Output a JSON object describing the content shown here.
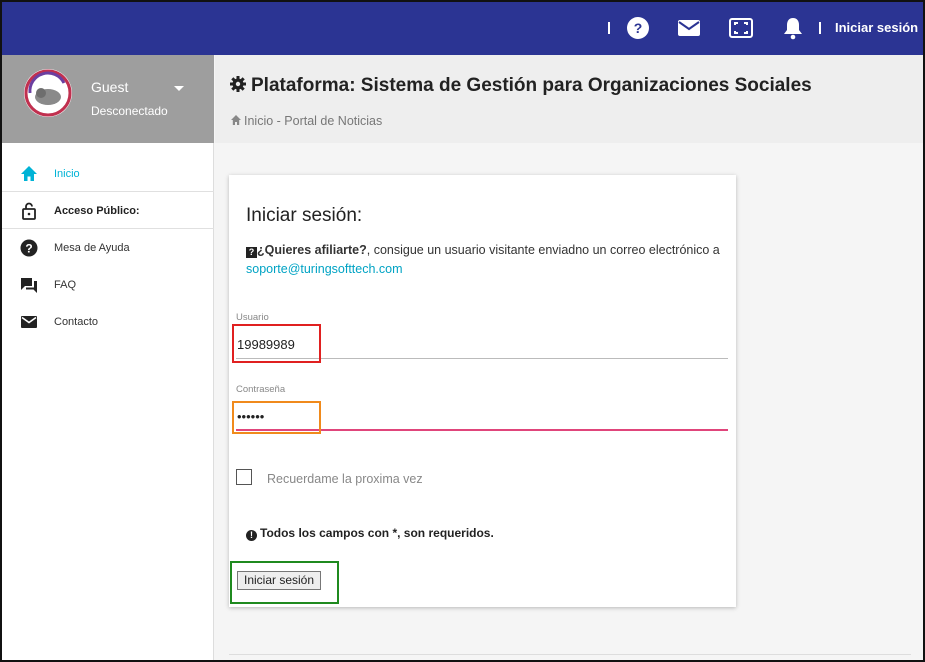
{
  "header": {
    "login_link": "Iniciar sesión",
    "icons": [
      "help-icon",
      "mail-icon",
      "fullscreen-icon",
      "bell-icon"
    ]
  },
  "user_panel": {
    "name": "Guest",
    "status": "Desconectado"
  },
  "sidebar": {
    "items": [
      {
        "label": "Inicio",
        "icon": "home-icon",
        "active": true
      },
      {
        "label": "Acceso Público:",
        "icon": "lock-open-icon",
        "section": true
      },
      {
        "label": "Mesa de Ayuda",
        "icon": "help-circle-icon"
      },
      {
        "label": "FAQ",
        "icon": "forum-icon"
      },
      {
        "label": "Contacto",
        "icon": "mail-icon"
      }
    ]
  },
  "page": {
    "title": "Plataforma: Sistema de Gestión para Organizaciones Sociales",
    "breadcrumb": "Inicio - Portal de Noticias"
  },
  "login": {
    "title": "Iniciar sesión:",
    "info_bold": "¿Quieres afiliarte?",
    "info_text": ", consigue un usuario visitante enviadno un correo electrónico a ",
    "email": "soporte@turingsofttech.com",
    "username_label": "Usuario",
    "username_value": "19989989",
    "password_label": "Contraseña",
    "password_value": "••••••",
    "remember_label": "Recuerdame la proxima vez",
    "required_note": "Todos los campos con *, son requeridos.",
    "submit_label": "Iniciar sesión"
  },
  "colors": {
    "topbar": "#2b3493",
    "accent_active": "#00b3d6",
    "focus_underline": "#e0457b",
    "highlight_username": "#e02020",
    "highlight_password": "#f08a1c",
    "highlight_button": "#1f8a1f"
  }
}
